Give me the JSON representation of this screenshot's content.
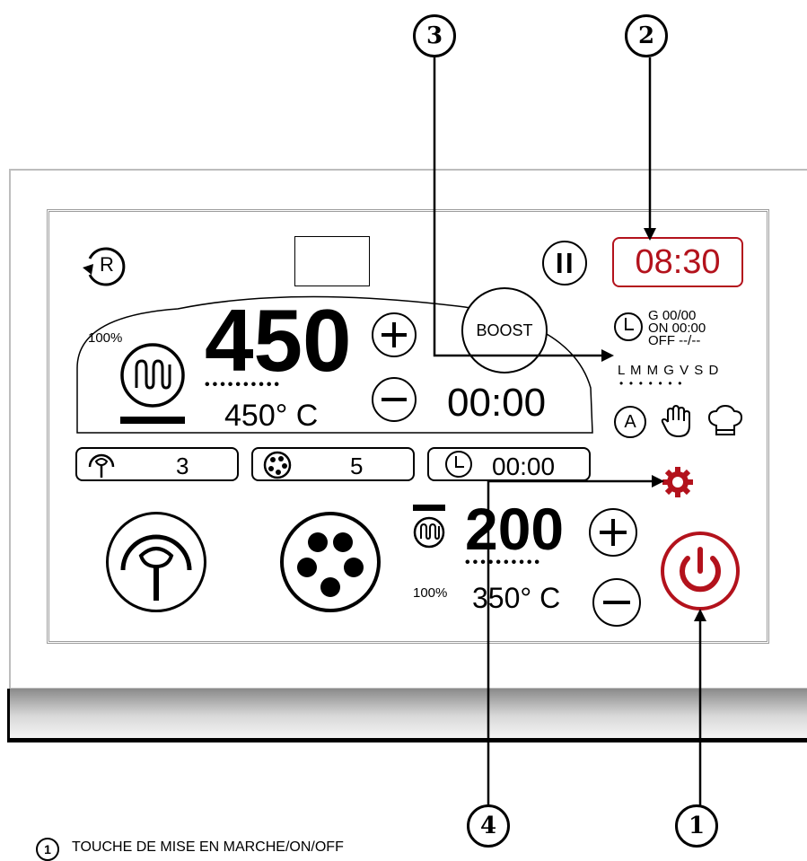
{
  "callouts": [
    "3",
    "2",
    "4",
    "1"
  ],
  "clock": "08:30",
  "reset_label": "R",
  "main": {
    "power_percent": "100%",
    "setpoint": "450",
    "actual_temp": "450° C",
    "timer": "00:00",
    "boost_label": "BOOST",
    "dots": "••••••••••"
  },
  "program": {
    "g": "G 00/00",
    "on": "ON 00:00",
    "off": "OFF --/--",
    "days": "L M M G V S D",
    "day_dots": "•  •  •  •  •  •  •"
  },
  "mode_a": "A",
  "pills": {
    "fan_value": "3",
    "hob_value": "5",
    "timer_value": "00:00"
  },
  "bottom": {
    "setpoint": "200",
    "actual_temp": "350° C",
    "power_percent": "100%",
    "dots": "••••••••••"
  },
  "legend": {
    "number": "1",
    "text": "TOUCHE DE MISE EN MARCHE/ON/OFF"
  },
  "colors": {
    "accent_red": "#b3121c"
  }
}
